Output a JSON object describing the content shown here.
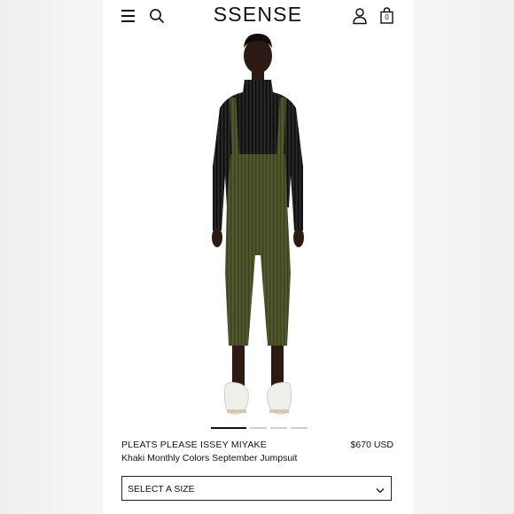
{
  "header": {
    "logo": "SSENSE",
    "bag_count": "0",
    "icons": {
      "menu": "hamburger-menu-icon",
      "search": "search-icon",
      "account": "account-icon",
      "bag": "shopping-bag-icon"
    }
  },
  "product": {
    "brand": "PLEATS PLEASE ISSEY MIYAKE",
    "name": "Khaki Monthly Colors September Jumpsuit",
    "price": "$670 USD",
    "image_count": 4,
    "active_image": 1,
    "colors": {
      "garment": "#4c5228",
      "top": "#1e1e1e"
    }
  },
  "size_selector": {
    "label": "SELECT A SIZE",
    "icon": "chevron-down-icon"
  }
}
